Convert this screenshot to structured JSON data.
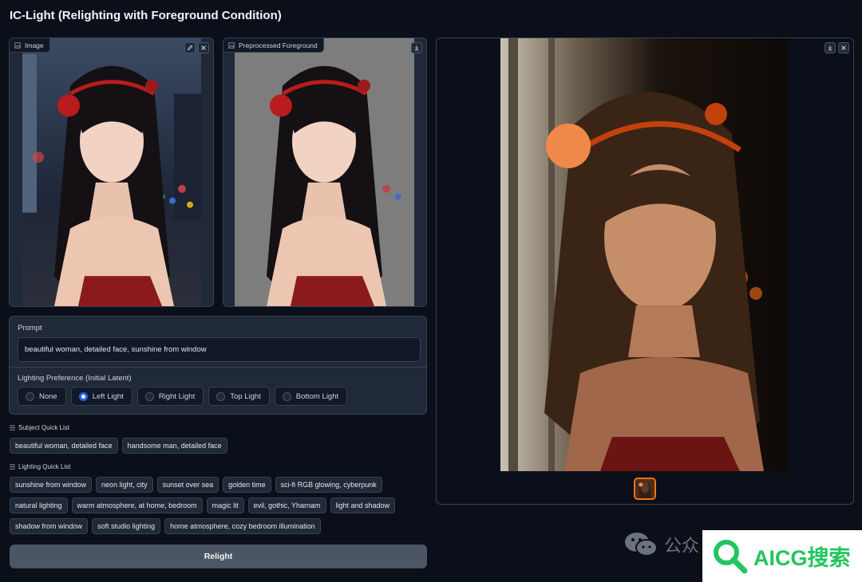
{
  "app": {
    "title": "IC-Light (Relighting with Foreground Condition)"
  },
  "input_panel": {
    "label": "Image"
  },
  "preprocessed_panel": {
    "label": "Preprocessed Foreground"
  },
  "prompt": {
    "label": "Prompt",
    "value": "beautiful woman, detailed face, sunshine from window"
  },
  "lighting": {
    "label": "Lighting Preference (Initial Latent)",
    "options": [
      "None",
      "Left Light",
      "Right Light",
      "Top Light",
      "Bottom Light"
    ],
    "selected": "Left Light"
  },
  "subject_quick_list": {
    "title": "Subject Quick List",
    "items": [
      "beautiful woman, detailed face",
      "handsome man, detailed face"
    ]
  },
  "lighting_quick_list": {
    "title": "Lighting Quick List",
    "items": [
      "sunshine from window",
      "neon light, city",
      "sunset over sea",
      "golden time",
      "sci-fi RGB glowing, cyberpunk",
      "natural lighting",
      "warm atmosphere, at home, bedroom",
      "magic lit",
      "evil, gothic, Yharnam",
      "light and shadow",
      "shadow from window",
      "soft studio lighting",
      "home atmosphere, cozy bedroom illumination"
    ]
  },
  "relight_button": {
    "label": "Relight"
  },
  "watermark": {
    "wechat_text": "公众",
    "brand_text": "AICG搜索"
  },
  "colors": {
    "accent": "#2563eb",
    "thumb_border": "#f97316",
    "brand": "#22c55e"
  }
}
